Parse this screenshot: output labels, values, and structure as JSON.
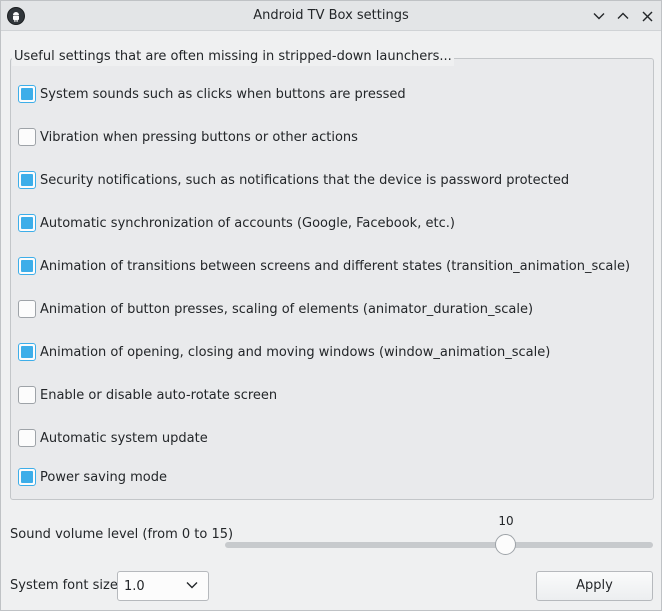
{
  "window": {
    "title": "Android TV Box settings",
    "accent_color": "#3daee9"
  },
  "group": {
    "title": "Useful settings that are often missing in stripped-down launchers...",
    "options": [
      {
        "label": "System sounds such as clicks when buttons are pressed",
        "checked": true
      },
      {
        "label": "Vibration when pressing buttons or other actions",
        "checked": false
      },
      {
        "label": "Security notifications, such as notifications that the device is password protected",
        "checked": true
      },
      {
        "label": "Automatic synchronization of accounts (Google, Facebook, etc.)",
        "checked": true
      },
      {
        "label": "Animation of transitions between screens and different states (transition_animation_scale)",
        "checked": true
      },
      {
        "label": "Animation of button presses, scaling of elements (animator_duration_scale)",
        "checked": false
      },
      {
        "label": "Animation of opening, closing and moving windows (window_animation_scale)",
        "checked": true
      },
      {
        "label": "Enable or disable auto-rotate screen",
        "checked": false
      },
      {
        "label": "Automatic system update",
        "checked": false
      },
      {
        "label": "Power saving mode",
        "checked": true
      }
    ]
  },
  "volume": {
    "label": "Sound volume level (from 0 to 15)",
    "value": "10",
    "min": 0,
    "max": 15
  },
  "font_size": {
    "label": "System font size",
    "selected": "1.0"
  },
  "apply_label": "Apply",
  "icons": {
    "app": "android-icon",
    "minimize": "chevron-down-icon",
    "maximize": "chevron-up-icon",
    "close": "close-icon",
    "dropdown": "chevron-down-icon"
  }
}
